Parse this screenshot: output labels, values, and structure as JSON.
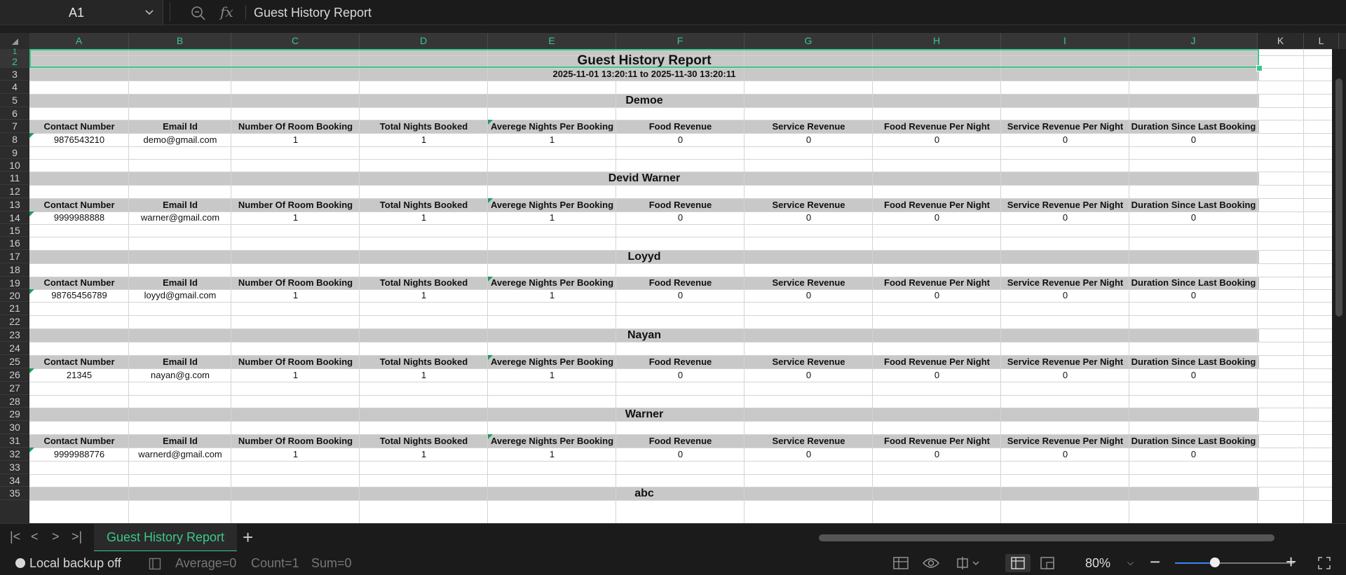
{
  "formula_bar": {
    "cell_ref": "A1",
    "formula_text": "Guest History Report"
  },
  "columns": [
    "A",
    "B",
    "C",
    "D",
    "E",
    "F",
    "G",
    "H",
    "I",
    "J",
    "K",
    "L"
  ],
  "rows": [
    "1",
    "2",
    "3",
    "4",
    "5",
    "6",
    "7",
    "8",
    "9",
    "10",
    "11",
    "12",
    "13",
    "14",
    "15",
    "16",
    "17",
    "18",
    "19",
    "20",
    "21",
    "22",
    "23",
    "24",
    "25",
    "26",
    "27",
    "28",
    "29",
    "30",
    "31",
    "32",
    "33",
    "34",
    "35"
  ],
  "report": {
    "title": "Guest History Report",
    "date_range": "2025-11-01 13:20:11 to 2025-11-30 13:20:11",
    "table_headers": [
      "Contact Number",
      "Email Id",
      "Number Of Room Booking",
      "Total Nights Booked",
      "Averege Nights Per Booking",
      "Food Revenue",
      "Service Revenue",
      "Food Revenue Per Night",
      "Service Revenue Per Night",
      "Duration Since Last Booking"
    ],
    "guests": [
      {
        "name": "Demoe",
        "row": [
          "9876543210",
          "demo@gmail.com",
          "1",
          "1",
          "1",
          "0",
          "0",
          "0",
          "0",
          "0"
        ]
      },
      {
        "name": "Devid Warner",
        "row": [
          "9999988888",
          "warner@gmail.com",
          "1",
          "1",
          "1",
          "0",
          "0",
          "0",
          "0",
          "0"
        ]
      },
      {
        "name": "Loyyd",
        "row": [
          "98765456789",
          "loyyd@gmail.com",
          "1",
          "1",
          "1",
          "0",
          "0",
          "0",
          "0",
          "0"
        ]
      },
      {
        "name": "Nayan",
        "row": [
          "21345",
          "nayan@g.com",
          "1",
          "1",
          "1",
          "0",
          "0",
          "0",
          "0",
          "0"
        ]
      },
      {
        "name": "Warner",
        "row": [
          "9999988776",
          "warnerd@gmail.com",
          "1",
          "1",
          "1",
          "0",
          "0",
          "0",
          "0",
          "0"
        ]
      },
      {
        "name": "abc",
        "row": []
      }
    ]
  },
  "sheet_tabs": {
    "active": "Guest History Report",
    "add_label": "+"
  },
  "status_bar": {
    "backup": "Local backup off",
    "average": "Average=0",
    "count": "Count=1",
    "sum": "Sum=0",
    "zoom": "80%"
  },
  "colors": {
    "accent": "#3cc78a",
    "band": "#c8c8c8"
  }
}
